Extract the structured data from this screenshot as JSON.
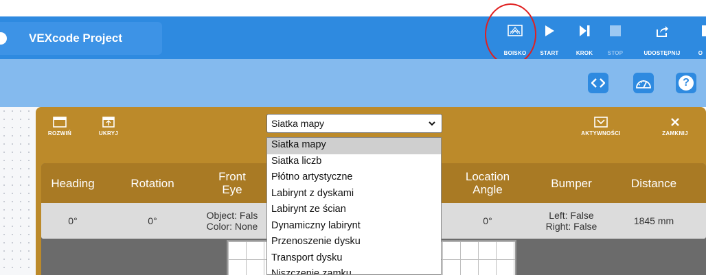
{
  "topbar": {
    "project_title": "VEXcode Project",
    "buttons": [
      {
        "label": "BOISKO",
        "icon": "playground-icon",
        "enabled": true
      },
      {
        "label": "START",
        "icon": "play-icon",
        "enabled": true
      },
      {
        "label": "KROK",
        "icon": "step-icon",
        "enabled": true
      },
      {
        "label": "STOP",
        "icon": "stop-icon",
        "enabled": false
      },
      {
        "label": "UDOSTĘPNIJ",
        "icon": "share-icon",
        "enabled": true
      },
      {
        "label": "O",
        "icon": "overflow-icon",
        "enabled": true
      }
    ]
  },
  "subbar": {
    "icons": [
      "code-icon",
      "dashboard-icon",
      "help-icon"
    ],
    "help_glyph": "?"
  },
  "panel": {
    "left_buttons": [
      {
        "label": "ROZWIŃ",
        "icon": "expand-icon"
      },
      {
        "label": "UKRYJ",
        "icon": "hide-icon"
      }
    ],
    "right_buttons": [
      {
        "label": "AKTYWNOŚCI",
        "icon": "activities-icon"
      },
      {
        "label": "ZAMKNIJ",
        "icon": "close-icon"
      }
    ],
    "select_value": "Siatka mapy"
  },
  "dashboard": {
    "headers": [
      "Heading",
      "Rotation",
      "Front\nEye",
      "Location\nAngle",
      "Bumper",
      "Distance"
    ],
    "values": [
      "0°",
      "0°",
      "Object: Fals\nColor: None",
      "0°",
      "Left: False\nRight: False",
      "1845 mm"
    ]
  },
  "dropdown": {
    "selected_index": 0,
    "options": [
      "Siatka mapy",
      "Siatka liczb",
      "Płótno artystyczne",
      "Labirynt z dyskami",
      "Labirynt ze ścian",
      "Dynamiczny labirynt",
      "Przenoszenie dysku",
      "Transport dysku",
      "Niszczenie zamku"
    ]
  },
  "colors": {
    "topbar": "#2e8ae0",
    "subbar": "#84baee",
    "panel": "#bc8a2a",
    "highlight_circle": "#e02020"
  }
}
